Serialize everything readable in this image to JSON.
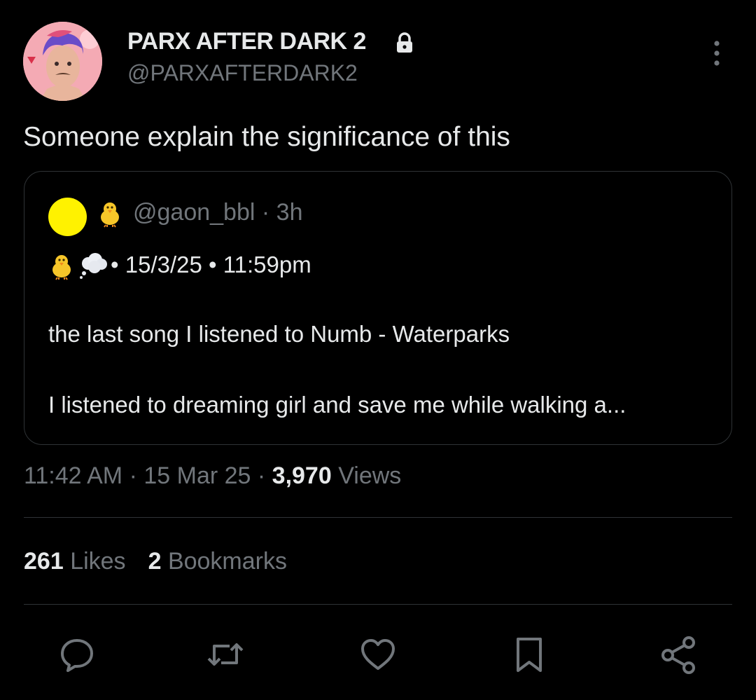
{
  "author": {
    "display_name": "PARX AFTER DARK 2",
    "handle": "@PARXAFTERDARK2",
    "protected_icon": "lock-icon"
  },
  "tweet": {
    "text": "Someone explain the significance of this"
  },
  "quote": {
    "avatar_color": "#fff200",
    "name_emoji": "chick-icon",
    "handle": "@gaon_bbl",
    "separator": "·",
    "time_ago": "3h",
    "line1": "• 15/3/25 • 11:59pm",
    "line2": "the last song I listened to Numb - Waterparks",
    "line3": "I listened to dreaming girl and save me while walking a..."
  },
  "meta": {
    "time": "11:42 AM",
    "sep1": " · ",
    "date": "15 Mar 25",
    "sep2": " · ",
    "views_count": "3,970",
    "views_label": " Views"
  },
  "stats": {
    "likes_count": "261",
    "likes_label": "Likes",
    "bookmarks_count": "2",
    "bookmarks_label": "Bookmarks"
  },
  "actions": [
    "reply-icon",
    "retweet-icon",
    "like-icon",
    "bookmark-icon",
    "share-icon"
  ],
  "colors": {
    "background": "#000000",
    "primary_text": "#e7e9ea",
    "secondary_text": "#71767b",
    "border": "#2f3336"
  }
}
